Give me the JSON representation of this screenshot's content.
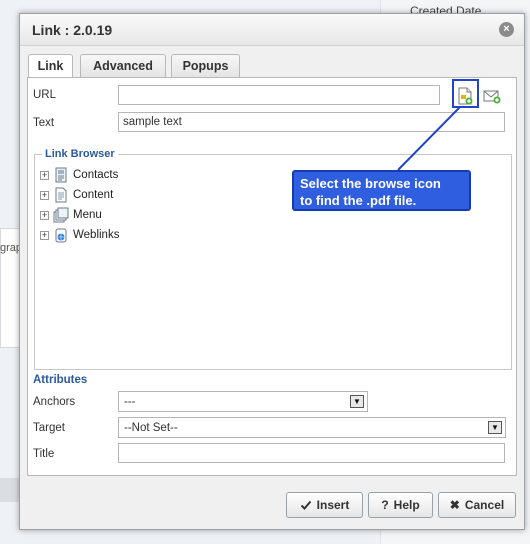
{
  "background": {
    "right_label": "Created Date",
    "left_label": "grap"
  },
  "dialog": {
    "title": "Link : 2.0.19",
    "close_glyph": "×"
  },
  "tabs": [
    {
      "label": "Link",
      "active": true
    },
    {
      "label": "Advanced",
      "active": false
    },
    {
      "label": "Popups",
      "active": false
    }
  ],
  "form": {
    "url_label": "URL",
    "url_value": "",
    "text_label": "Text",
    "text_value": "sample text",
    "browse_icon": "browse-file-icon",
    "email_icon": "email-link-icon"
  },
  "link_browser": {
    "legend": "Link Browser",
    "items": [
      {
        "label": "Contacts",
        "icon": "contacts-icon"
      },
      {
        "label": "Content",
        "icon": "content-icon"
      },
      {
        "label": "Menu",
        "icon": "menu-icon"
      },
      {
        "label": "Weblinks",
        "icon": "weblinks-icon"
      }
    ]
  },
  "callout": {
    "line1": "Select the browse icon",
    "line2": "to find the .pdf file."
  },
  "attributes": {
    "title": "Attributes",
    "anchors_label": "Anchors",
    "anchors_value": "---",
    "target_label": "Target",
    "target_value": "--Not Set--",
    "title_label": "Title",
    "title_value": ""
  },
  "buttons": {
    "insert": "Insert",
    "help": "Help",
    "cancel": "Cancel"
  },
  "colors": {
    "accent_blue": "#2b5a9c",
    "callout_blue": "#2f5fe0",
    "highlight": "#1f43c9"
  }
}
